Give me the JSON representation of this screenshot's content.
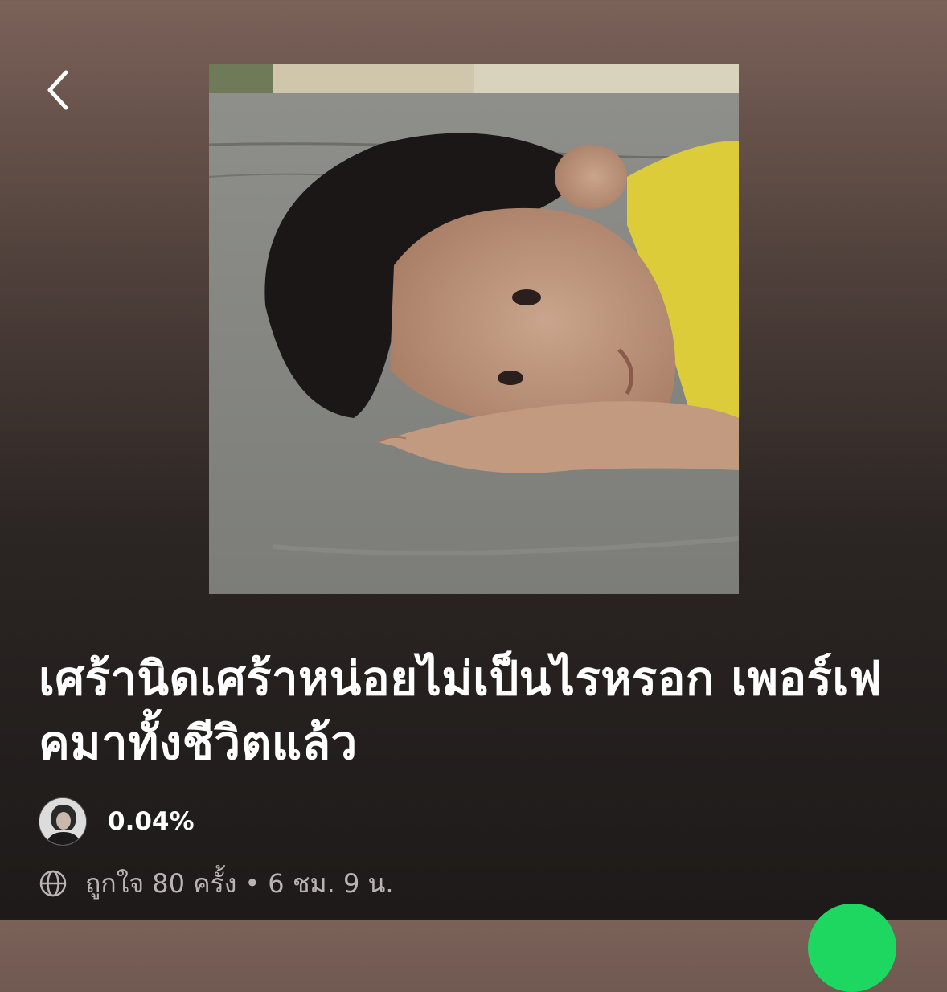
{
  "header": {
    "back_icon": "chevron-left-icon"
  },
  "playlist": {
    "title": "เศร้านิดเศร้าหน่อยไม่เป็นไรหรอก เพอร์เฟคมาทั้งชีวิตแล้ว",
    "owner_label": "0.04%",
    "visibility_icon": "globe-icon",
    "likes_text": "ถูกใจ 80 ครั้ง",
    "separator": "•",
    "duration_text": "6 ชม. 9 น."
  },
  "colors": {
    "accent": "#1ed760",
    "meta": "#b9b4b2"
  }
}
